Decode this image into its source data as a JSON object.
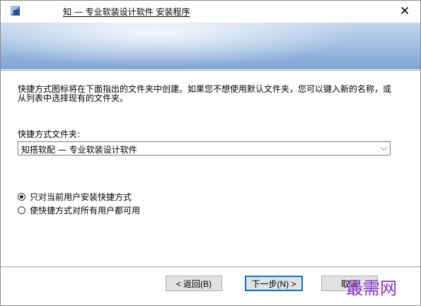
{
  "window": {
    "title": "知 — 专业软装设计软件 安装程序",
    "close_glyph": "✕"
  },
  "instruction": "快捷方式图标将在下面指出的文件夹中创建。如果您不想使用默认文件夹，您可以键入新的名称，或从列表中选择现有的文件夹。",
  "folder": {
    "label": "快捷方式文件夹:",
    "value": "知搭软配 — 专业软装设计软件",
    "arrow_glyph": "⌵"
  },
  "options": [
    {
      "label": "只对当前用户安装快捷方式",
      "selected": true
    },
    {
      "label": "使快捷方式对所有用户都可用",
      "selected": false
    }
  ],
  "buttons": {
    "back": "< 返回(B)",
    "next": "下一步(N) >",
    "cancel": "取消"
  },
  "watermark": "最需网",
  "colors": {
    "accent": "#0078d7",
    "banner_light": "#c4d7ee",
    "banner_dark": "#7fa3d4",
    "watermark": "#8a2dd0"
  },
  "icons": {
    "app": "installer-app-icon",
    "close": "close-icon",
    "dropdown": "chevron-down-icon"
  }
}
